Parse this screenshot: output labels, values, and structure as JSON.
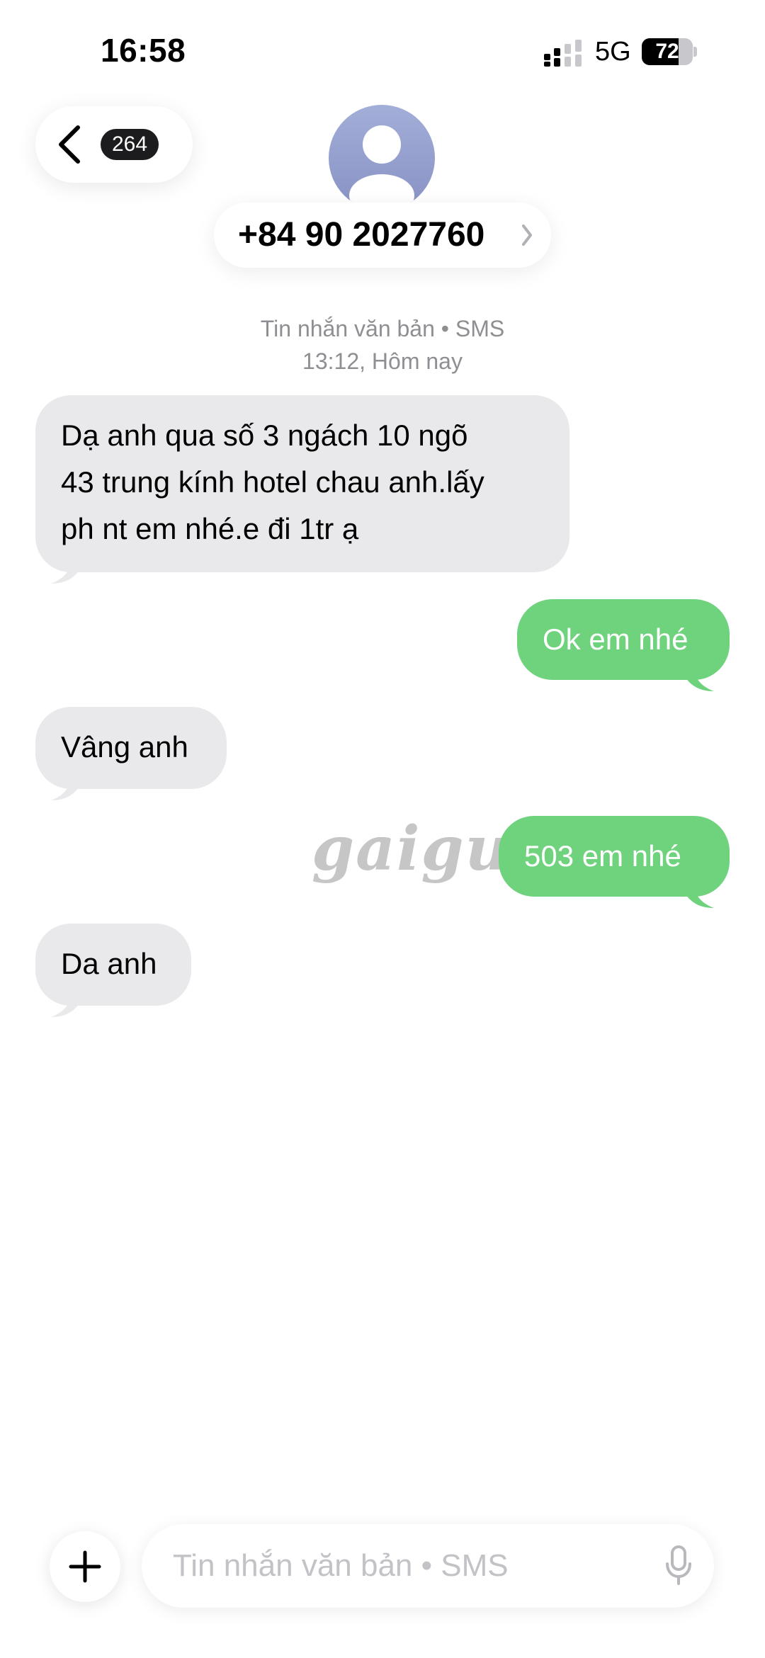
{
  "status_bar": {
    "time": "16:58",
    "network": "5G",
    "battery_percent": "72",
    "battery_level": 0.72,
    "signal_icon": "cellular-signal-icon"
  },
  "header": {
    "back_badge": "264",
    "contact": "+84 90 2027760",
    "avatar_icon": "person-silhouette-icon",
    "chevron_icon": "chevron-right-icon"
  },
  "conversation": {
    "meta_type": "Tin nhắn văn bản • SMS",
    "meta_time": "13:12, Hôm nay",
    "messages": [
      {
        "direction": "received",
        "lines": [
          "Dạ anh qua số 3 ngách 10 ngõ",
          "43 trung kính hotel chau anh.lấy",
          "ph nt em nhé.e đi 1tr ạ"
        ]
      },
      {
        "direction": "sent",
        "text": "Ok em nhé"
      },
      {
        "direction": "received",
        "text": "Vâng anh"
      },
      {
        "direction": "sent",
        "text": "503 em nhé"
      },
      {
        "direction": "received",
        "text": "Da anh"
      }
    ]
  },
  "watermark": "gaigu",
  "composer": {
    "placeholder": "Tin nhắn văn bản • SMS",
    "plus_icon": "plus-icon",
    "mic_icon": "microphone-icon"
  },
  "colors": {
    "sent_bubble": "#6fd37e",
    "received_bubble": "#e9e9eb",
    "badge_bg": "#1c1c1e",
    "meta_text": "#8e8e93",
    "avatar_gradient_top": "#a3aed8",
    "avatar_gradient_bottom": "#8792c4"
  }
}
